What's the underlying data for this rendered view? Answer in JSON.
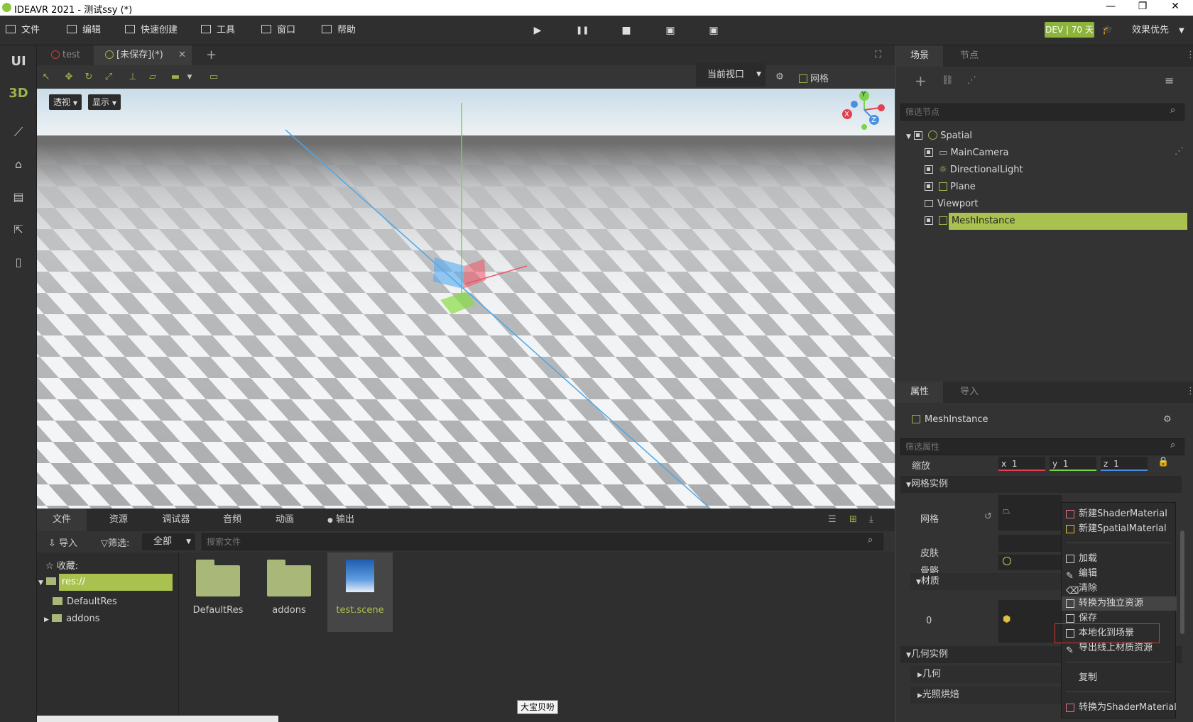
{
  "window": {
    "title": "IDEAVR 2021 - 测试ssy (*)",
    "minimize": "—",
    "restore": "❐",
    "close": "✕"
  },
  "menu": [
    {
      "label": "文件",
      "icon": "folder-icon"
    },
    {
      "label": "编辑",
      "icon": "crop-icon"
    },
    {
      "label": "快速创建",
      "icon": "edit-icon"
    },
    {
      "label": "工具",
      "icon": "window-icon"
    },
    {
      "label": "窗口",
      "icon": "frame-icon"
    },
    {
      "label": "帮助",
      "icon": "book-icon"
    }
  ],
  "playback": {
    "play": "▶",
    "pause": "❚❚",
    "stop": "■",
    "clip1": "▣",
    "clip2": "▣"
  },
  "license": "DEV | 70 天",
  "quality": "效果优先",
  "leftbar": {
    "ui": "UI",
    "three_d": "3D"
  },
  "scene_tabs": [
    {
      "label": "test"
    },
    {
      "label": "[未保存](*)"
    }
  ],
  "add_tab": "+",
  "viewport": {
    "view_mode": "当前视口",
    "grid_label": "网格",
    "perspective": "透视",
    "display": "显示",
    "gizmo": {
      "x": "X",
      "y": "Y",
      "z": "Z"
    }
  },
  "bottom": {
    "tabs": [
      "文件",
      "资源",
      "调试器",
      "音频",
      "动画",
      "输出"
    ],
    "import_label": "导入",
    "filter_label": "筛选:",
    "filter_value": "全部",
    "search_placeholder": "搜索文件",
    "favorites": "收藏:",
    "tree": [
      "res://",
      "DefaultRes",
      "addons"
    ],
    "files": [
      "DefaultRes",
      "addons",
      "test.scene"
    ]
  },
  "scene_panel": {
    "tabs": [
      "场景",
      "节点"
    ],
    "filter_placeholder": "筛选节点",
    "nodes": [
      "Spatial",
      "MainCamera",
      "DirectionalLight",
      "Plane",
      "Viewport",
      "MeshInstance"
    ]
  },
  "props_panel": {
    "tabs": [
      "属性",
      "导入"
    ],
    "object": "MeshInstance",
    "filter_placeholder": "筛选属性",
    "scale_label": "缩放",
    "scale": {
      "x": "1",
      "y": "1",
      "z": "1"
    },
    "section_mesh": "网格实例",
    "mesh_label": "网格",
    "skin_label": "皮肤",
    "skeleton_label": "骨骼",
    "material_section": "材质",
    "material_index": "0",
    "section_geometry": "几何实例",
    "geometry": "几何",
    "light_bake": "光照烘焙"
  },
  "context_menu": [
    "新建ShaderMaterial",
    "新建SpatialMaterial",
    "加载",
    "编辑",
    "清除",
    "转换为独立资源",
    "保存",
    "本地化到场景",
    "导出线上材质资源",
    "复制",
    "转换为ShaderMaterial"
  ],
  "tooltip": "大宝贝吩"
}
